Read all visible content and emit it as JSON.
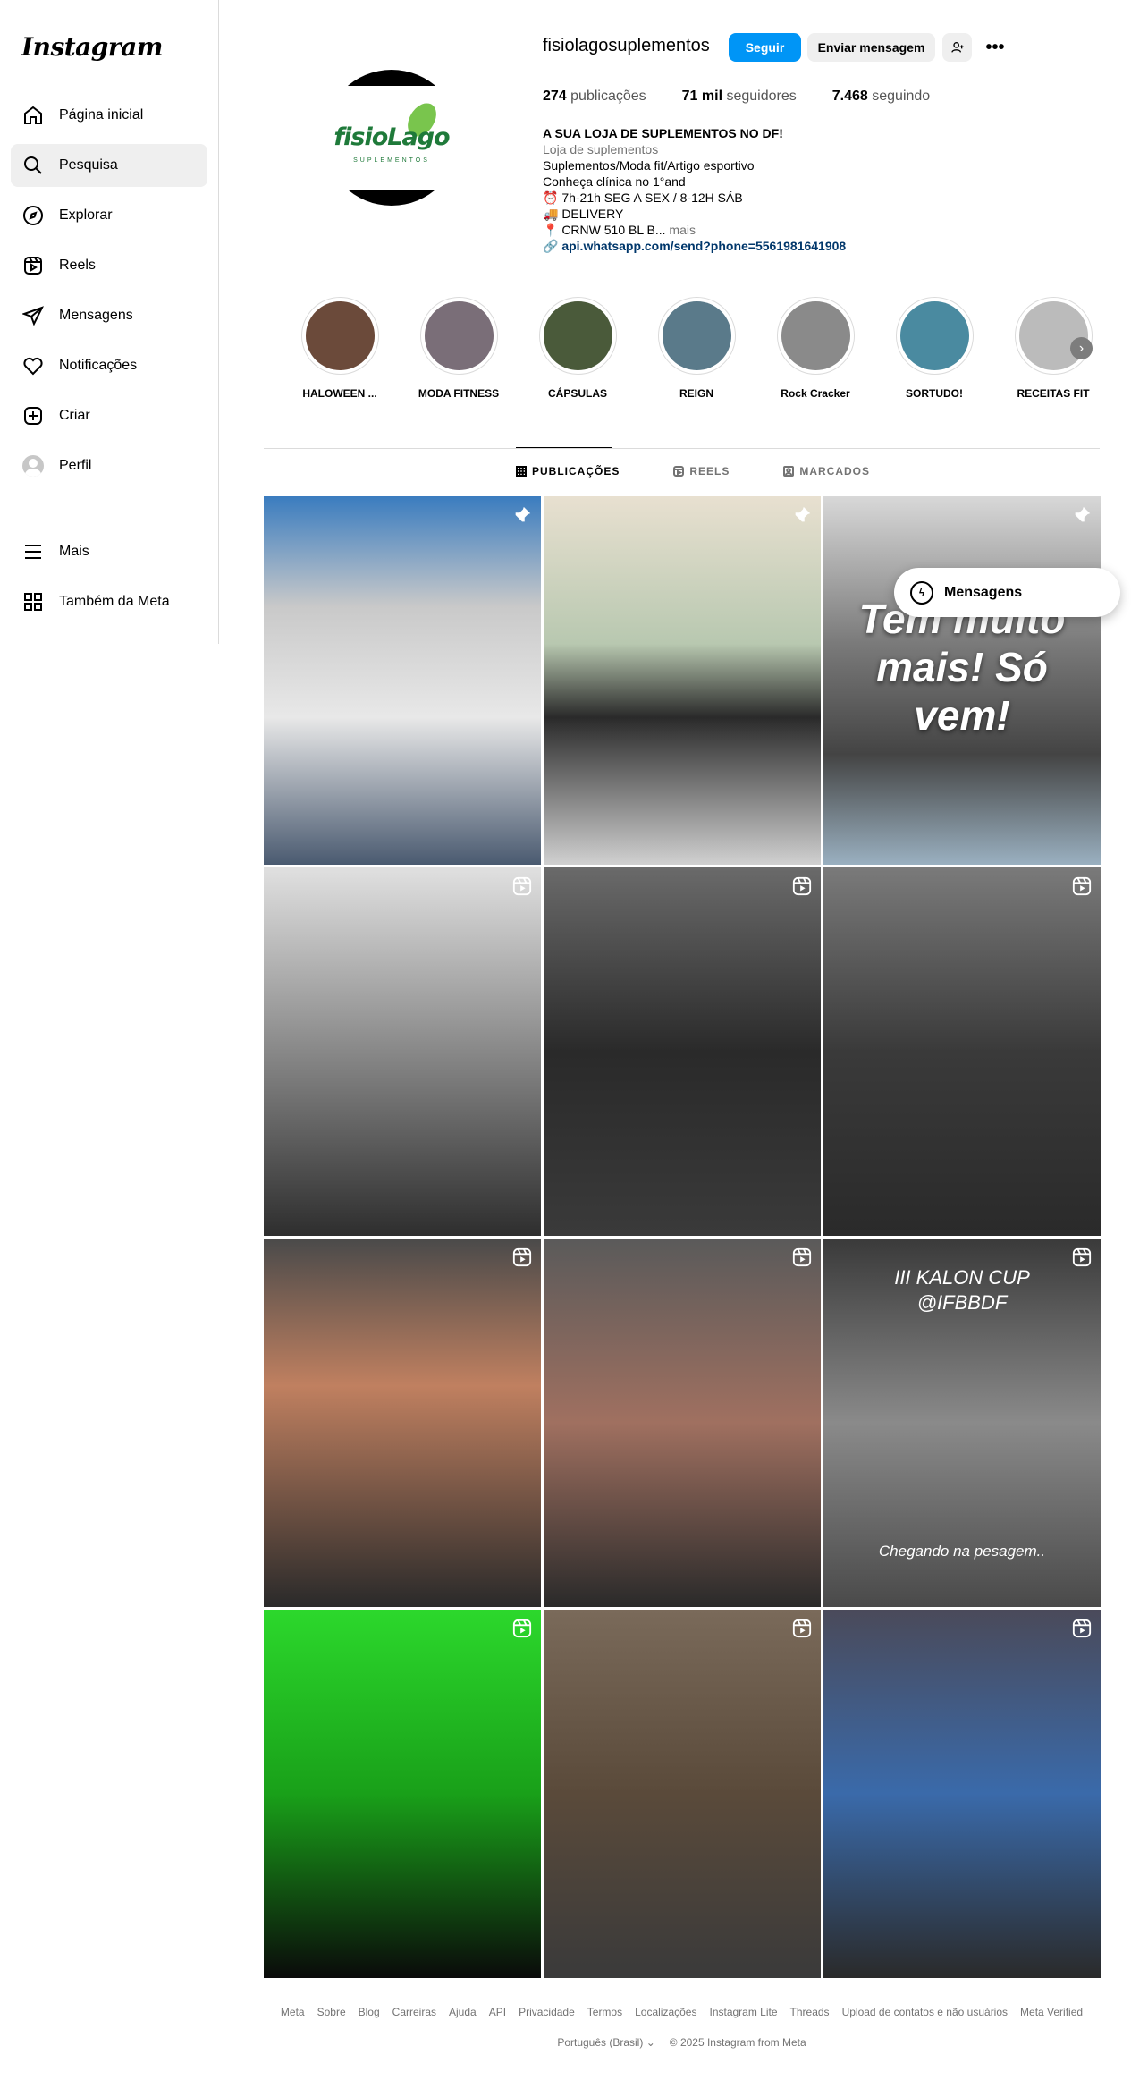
{
  "app": {
    "logo_text": "Instagram"
  },
  "sidebar": {
    "items": [
      {
        "label": "Página inicial",
        "icon": "home-icon"
      },
      {
        "label": "Pesquisa",
        "icon": "search-icon"
      },
      {
        "label": "Explorar",
        "icon": "compass-icon"
      },
      {
        "label": "Reels",
        "icon": "reels-icon"
      },
      {
        "label": "Mensagens",
        "icon": "send-icon"
      },
      {
        "label": "Notificações",
        "icon": "heart-icon"
      },
      {
        "label": "Criar",
        "icon": "plus-square-icon"
      },
      {
        "label": "Perfil",
        "icon": "avatar"
      }
    ],
    "more_label": "Mais",
    "meta_label": "Também da Meta"
  },
  "profile": {
    "username": "fisiolagosuplementos",
    "follow_label": "Seguir",
    "message_label": "Enviar mensagem",
    "stats": {
      "posts_count": "274",
      "posts_label": "publicações",
      "followers_count": "71 mil",
      "followers_label": "seguidores",
      "following_count": "7.468",
      "following_label": "seguindo"
    },
    "bio": {
      "name": "A SUA LOJA DE SUPLEMENTOS NO DF!",
      "category": "Loja de suplementos",
      "line1": "Suplementos/Moda fit/Artigo esportivo",
      "line2": "Conheça clínica no 1°and",
      "line3": "⏰ 7h-21h SEG A SEX / 8-12H SÁB",
      "line4": "🚚 DELIVERY",
      "line5": "📍 CRNW 510 BL B...",
      "more": "mais",
      "link": "api.whatsapp.com/send?phone=5561981641908"
    },
    "avatar_brand": "fisioLago",
    "avatar_sub": "SUPLEMENTOS"
  },
  "highlights": [
    {
      "label": "HALOWEEN ...",
      "color": "#6b4a3a"
    },
    {
      "label": "MODA FITNESS",
      "color": "#7a6e78"
    },
    {
      "label": "CÁPSULAS",
      "color": "#4a5a3a"
    },
    {
      "label": "REIGN",
      "color": "#5a7a8a"
    },
    {
      "label": "Rock Cracker",
      "color": "#8a8a8a"
    },
    {
      "label": "SORTUDO!",
      "color": "#4a8aa0"
    },
    {
      "label": "RECEITAS FIT",
      "color": "#bbbbbb"
    }
  ],
  "tabs": [
    {
      "label": "PUBLICAÇÕES",
      "icon": "grid-icon",
      "active": true
    },
    {
      "label": "REELS",
      "icon": "reels-icon",
      "active": false
    },
    {
      "label": "MARCADOS",
      "icon": "tagged-icon",
      "active": false
    }
  ],
  "posts": [
    {
      "type": "pinned",
      "bg": "linear-gradient(180deg,#3a7cbf 0%,#c9c9c9 30%,#e8e8e8 60%,#4a5a70 100%)"
    },
    {
      "type": "pinned",
      "bg": "linear-gradient(180deg,#e8e0d0 0%,#b8c8b0 40%,#2a2a2a 60%,#d0d0d0 100%)"
    },
    {
      "type": "pinned",
      "bg": "linear-gradient(180deg,#d8d8d8 0%,#7a7a7a 40%,#444 70%,#9ab0c0 100%)",
      "caption": "Tem muito mais! Só vem!"
    },
    {
      "type": "reel",
      "bg": "linear-gradient(180deg,#e0e0e0 0%,#9a9a9a 40%,#2e2e2e 100%)"
    },
    {
      "type": "reel",
      "bg": "linear-gradient(180deg,#6a6a6a 0%,#2a2a2a 50%,#3a3a3a 100%)"
    },
    {
      "type": "reel",
      "bg": "linear-gradient(180deg,#7a7a7a 0%,#3a3a3a 50%,#2a2a2a 100%)"
    },
    {
      "type": "reel",
      "bg": "linear-gradient(180deg,#4a4a4a 0%,#c08060 40%,#2a2a2a 100%)"
    },
    {
      "type": "reel",
      "bg": "linear-gradient(180deg,#5a5a5a 0%,#a07060 50%,#2a2a2a 100%)"
    },
    {
      "type": "reel",
      "bg": "linear-gradient(180deg,#3a3a3a 0%,#8a8a8a 50%,#4a4a4a 100%)",
      "caption": "III KALON CUP @IFBBDF",
      "caption2": "Chegando na pesagem.."
    },
    {
      "type": "reel",
      "bg": "linear-gradient(180deg,#2cd82c 0%,#19a019 50%,#0a0a0a 100%)"
    },
    {
      "type": "reel",
      "bg": "linear-gradient(180deg,#7a6a5a 0%,#5a4a3a 50%,#3a3a3a 100%)"
    },
    {
      "type": "reel",
      "bg": "linear-gradient(180deg,#4a4a5a 0%,#3a6aaa 50%,#2a2a2a 100%)"
    }
  ],
  "messages_pill": {
    "label": "Mensagens"
  },
  "footer": {
    "links": [
      "Meta",
      "Sobre",
      "Blog",
      "Carreiras",
      "Ajuda",
      "API",
      "Privacidade",
      "Termos",
      "Localizações",
      "Instagram Lite",
      "Threads",
      "Upload de contatos e não usuários",
      "Meta Verified"
    ],
    "language": "Português (Brasil)",
    "copyright": "© 2025 Instagram from Meta"
  }
}
